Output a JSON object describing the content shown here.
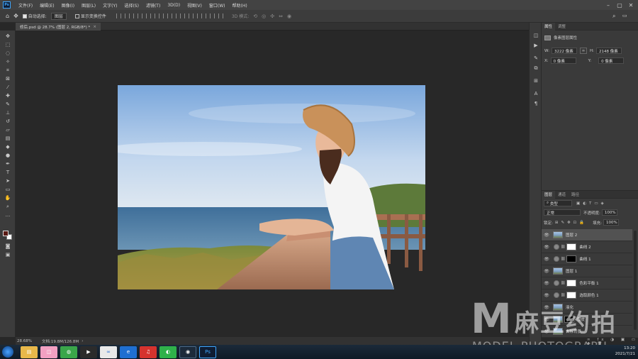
{
  "app": {
    "logo": "Ps",
    "menu": [
      "文件(F)",
      "编辑(E)",
      "图像(I)",
      "图层(L)",
      "文字(Y)",
      "选择(S)",
      "滤镜(T)",
      "3D(D)",
      "视图(V)",
      "窗口(W)",
      "帮助(H)"
    ]
  },
  "options": {
    "auto_select_label": "自动选择:",
    "auto_select_target": "图层",
    "transform_label": "显示变换控件",
    "mode_label": "3D 模式:"
  },
  "document": {
    "tab_title": "修后.psd @ 28.7% (图层 2, RGB/8*) *",
    "close": "×"
  },
  "status": {
    "zoom": "28.68%",
    "doc_size": "文档:19.8M/126.8M"
  },
  "properties": {
    "tabs": [
      "属性",
      "调整"
    ],
    "type_label": "像素图层属性",
    "w_label": "W:",
    "w_value": "3222 像素",
    "h_label": "H:",
    "h_value": "2148 像素",
    "x_label": "X:",
    "x_value": "0 像素",
    "y_label": "Y:",
    "y_value": "0 像素",
    "link_icon": "link-icon"
  },
  "layers": {
    "tabs": [
      "图层",
      "通道",
      "路径"
    ],
    "filter_label": "类型",
    "blend_mode": "正常",
    "opacity_label": "不透明度:",
    "opacity_value": "100%",
    "lock_label": "锁定:",
    "fill_label": "填充:",
    "fill_value": "100%",
    "items": [
      {
        "name": "图层 2",
        "kind": "photo",
        "selected": true
      },
      {
        "name": "曲线 2",
        "kind": "adj-white"
      },
      {
        "name": "曲线 1",
        "kind": "adj-black"
      },
      {
        "name": "图层 1",
        "kind": "photo"
      },
      {
        "name": "色彩平衡 1",
        "kind": "adj-white"
      },
      {
        "name": "选取颜色 1",
        "kind": "adj-white"
      },
      {
        "name": "液化",
        "kind": "photo"
      },
      {
        "name": "磨皮",
        "kind": "photo-mask"
      },
      {
        "name": "去除背景",
        "kind": "photo"
      }
    ]
  },
  "watermark": {
    "letter": "M",
    "cn": "麻豆约拍",
    "en": "MODEL PHOTOGRAPH"
  },
  "taskbar": {
    "time": "13:20",
    "date": "2021/7/21"
  },
  "colors": {
    "foreground": "#5a1a14",
    "background": "#ffffff",
    "accent": "#3ea6ff"
  }
}
